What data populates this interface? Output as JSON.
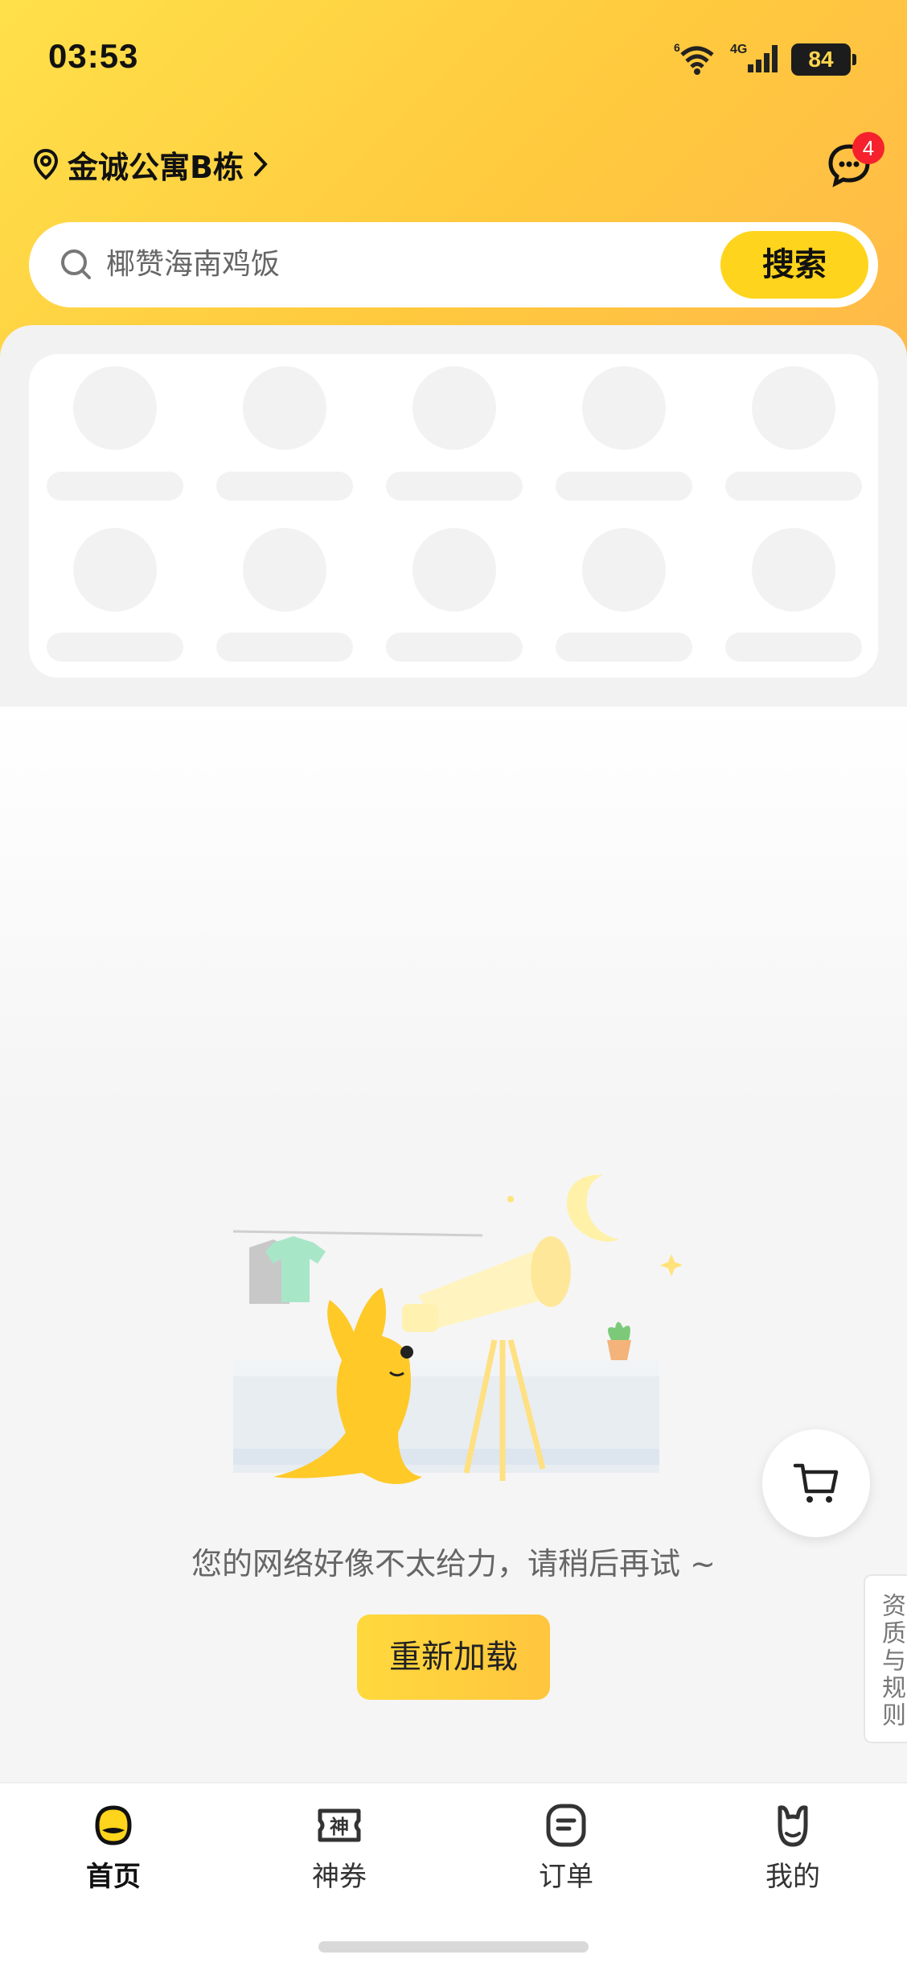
{
  "status_bar": {
    "time": "03:53",
    "wifi_tag": "6",
    "network": "4G",
    "battery": "84"
  },
  "header": {
    "location": "金诚公寓B栋",
    "message_count": "4"
  },
  "search": {
    "placeholder": "椰赞海南鸡饭",
    "button": "搜索"
  },
  "error": {
    "message": "您的网络好像不太给力，请稍后再试 ~",
    "reload_button": "重新加载"
  },
  "side_tab": {
    "label": "资质与规则"
  },
  "tabbar": {
    "items": [
      {
        "label": "首页",
        "icon": "home-duck-icon",
        "active": true
      },
      {
        "label": "神券",
        "icon": "coupon-shen-icon",
        "active": false
      },
      {
        "label": "订单",
        "icon": "order-icon",
        "active": false
      },
      {
        "label": "我的",
        "icon": "profile-kangaroo-icon",
        "active": false
      }
    ]
  },
  "colors": {
    "brand_yellow": "#ffd41c",
    "badge_red": "#f5222d"
  }
}
